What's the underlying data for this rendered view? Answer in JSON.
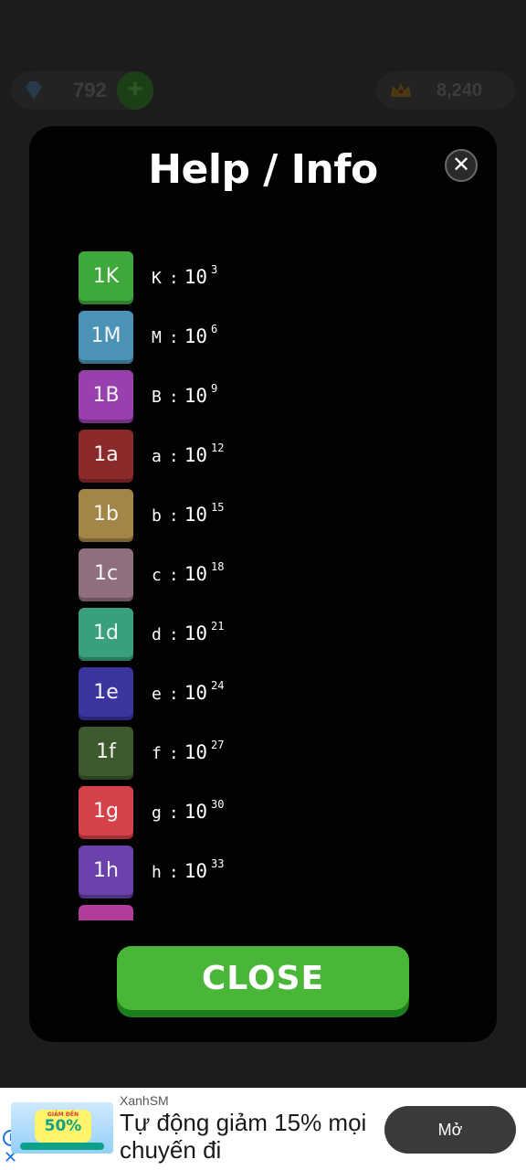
{
  "background": {
    "gems": "792",
    "gems_add": "+",
    "crowns": "8,240"
  },
  "modal": {
    "title": "Help / Info",
    "close_icon": "✕",
    "items": [
      {
        "tile": "1K",
        "letter": "K",
        "base": "10",
        "exp": "3",
        "color": "#3ea83a"
      },
      {
        "tile": "1M",
        "letter": "M",
        "base": "10",
        "exp": "6",
        "color": "#4a93b6"
      },
      {
        "tile": "1B",
        "letter": "B",
        "base": "10",
        "exp": "9",
        "color": "#9a3fae"
      },
      {
        "tile": "1a",
        "letter": "a",
        "base": "10",
        "exp": "12",
        "color": "#8a2a2a"
      },
      {
        "tile": "1b",
        "letter": "b",
        "base": "10",
        "exp": "15",
        "color": "#a38545"
      },
      {
        "tile": "1c",
        "letter": "c",
        "base": "10",
        "exp": "18",
        "color": "#8f6e80"
      },
      {
        "tile": "1d",
        "letter": "d",
        "base": "10",
        "exp": "21",
        "color": "#39a07f"
      },
      {
        "tile": "1e",
        "letter": "e",
        "base": "10",
        "exp": "24",
        "color": "#3b35a0"
      },
      {
        "tile": "1f",
        "letter": "f",
        "base": "10",
        "exp": "27",
        "color": "#3d5a2c"
      },
      {
        "tile": "1g",
        "letter": "g",
        "base": "10",
        "exp": "30",
        "color": "#d6424a"
      },
      {
        "tile": "1h",
        "letter": "h",
        "base": "10",
        "exp": "33",
        "color": "#6b42ab"
      },
      {
        "tile": "",
        "letter": "",
        "base": "",
        "exp": "",
        "color": "#b23c9a"
      }
    ],
    "close_button": "CLOSE"
  },
  "ad": {
    "badge_small": "GIẢM ĐẾN",
    "badge_big": "50%",
    "brand": "XanhSM",
    "headline": "Tự động giảm 15% mọi chuyến đi",
    "cta": "Mở",
    "info_icon": "i",
    "close_icon": "✕"
  }
}
